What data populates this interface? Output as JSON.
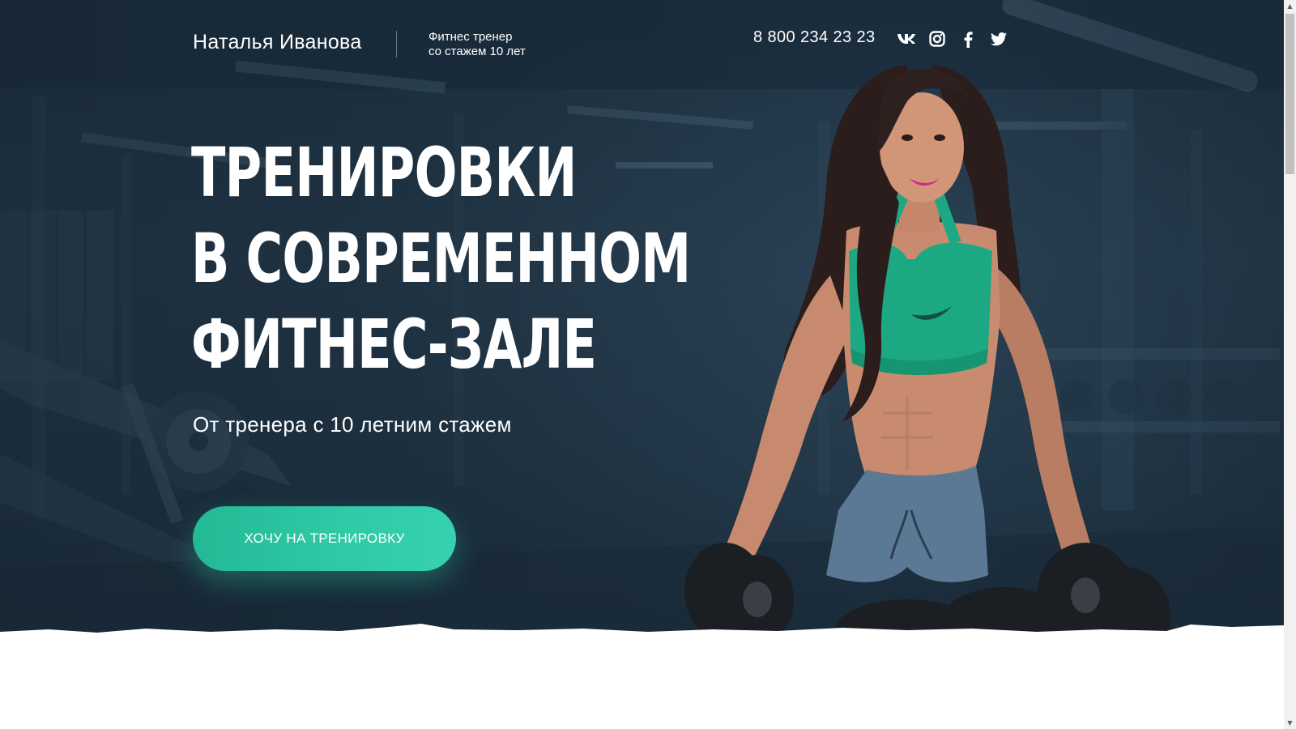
{
  "header": {
    "name": "Наталья Иванова",
    "subtitle_line1": "Фитнес тренер",
    "subtitle_line2": "со стажем 10 лет",
    "phone": "8 800 234 23 23",
    "socials": [
      {
        "icon": "vk-icon",
        "label": "VK"
      },
      {
        "icon": "instagram-icon",
        "label": "Instagram"
      },
      {
        "icon": "facebook-icon",
        "label": "Facebook"
      },
      {
        "icon": "twitter-icon",
        "label": "Twitter"
      }
    ]
  },
  "hero": {
    "headline_line1": "ТРЕНИРОВКИ",
    "headline_line2": "В СОВРЕМЕННОМ",
    "headline_line3": "ФИТНЕС-ЗАЛЕ",
    "subheadline": "От тренера с 10 летним стажем",
    "cta_label": "ХОЧУ НА ТРЕНИРОВКУ",
    "image": "trainer-with-dumbbells-photo"
  },
  "colors": {
    "accent": "#2fc9a6",
    "hero_bg": "#223748",
    "text": "#ffffff"
  },
  "scrollbar": {
    "up_icon": "scroll-up-arrow-icon",
    "down_icon": "scroll-down-arrow-icon"
  }
}
